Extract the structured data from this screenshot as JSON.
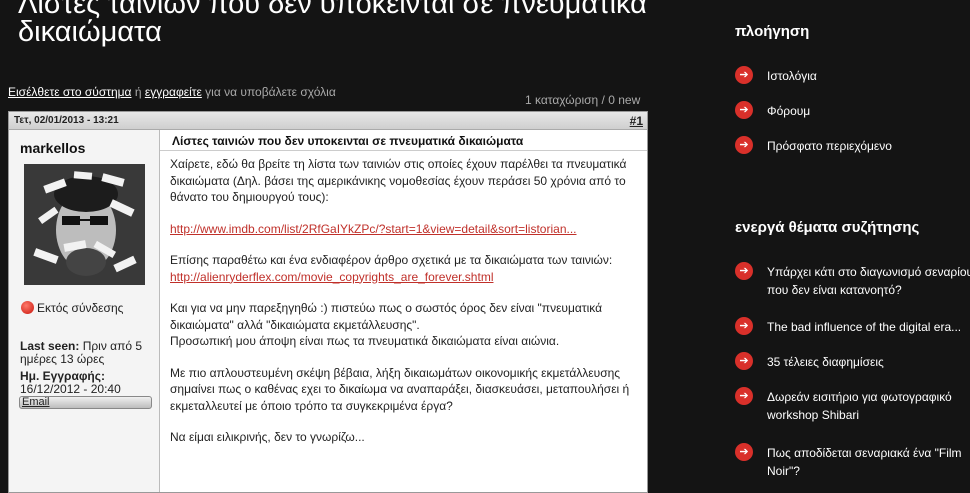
{
  "page": {
    "title": "Λίστες ταινιών που δεν υπόκεινται σε πνευματικά δικαιώματα",
    "login_link": "Εισέλθετε στο σύστημα",
    "login_or": " ή ",
    "register_link": "εγγραφείτε",
    "login_suffix": " για να υποβάλετε σχόλια",
    "post_count": "1 καταχώριση / 0 new"
  },
  "post": {
    "date": "Τετ, 02/01/2013 - 13:21",
    "number": "#1",
    "author": {
      "name": "markellos",
      "status": "Εκτός σύνδεσης",
      "last_seen_label": "Last seen:",
      "last_seen_value": " Πριν από 5 ημέρες 13 ώρες",
      "registered_label": "Ημ. Εγγραφής:",
      "registered_value": "16/12/2012 - 20:40",
      "email_button": "Email"
    },
    "subject": "Λίστες ταινιών που δεν υποκεινται σε πνευματικά δικαιώματα",
    "p1": "Χαίρετε, εδώ θα βρείτε τη λίστα των ταινιών στις οποίες έχουν παρέλθει τα πνευματικά δικαιώματα (Δηλ. βάσει της αμερικάνικης νομοθεσίας έχουν περάσει 50 χρόνια από το θάνατο του δημιουργού τους):",
    "link1": "http://www.imdb.com/list/2RfGaIYkZPc/?start=1&view=detail&sort=listorian...",
    "p2": "Επίσης παραθέτω και ένα ενδιαφέρον άρθρο σχετικά με τα δικαιώματα των ταινιών:",
    "link2": "http://alienryderflex.com/movie_copyrights_are_forever.shtml",
    "p3a": "Και για να μην παρεξηγηθώ :) πιστεύω πως ο σωστός όρος δεν είναι \"πνευματικά δικαιώματα\" αλλά \"δικαιώματα εκμετάλλευσης\".",
    "p3b": "Προσωπική μου άποψη είναι πως τα πνευματικά δικαιώματα είναι αιώνια.",
    "p4": "Με πιο απλουστευμένη σκέψη βέβαια, λήξη δικαιωμάτων οικονομικής εκμετάλλευσης σημαίνει πως ο καθένας εχει το δικαίωμα να αναπαράξει, διασκευάσει, μεταπουλήσει ή εκμεταλλευτεί με όποιο τρόπο τα συγκεκριμένα έργα?",
    "p5": "Να είμαι ειλικρινής, δεν το γνωρίζω..."
  },
  "sidebar": {
    "nav_heading": "πλοήγηση",
    "nav_items": [
      {
        "label": "Ιστολόγια"
      },
      {
        "label": "Φόρουμ"
      },
      {
        "label": "Πρόσφατο περιεχόμενο"
      }
    ],
    "topics_heading": "ενεργά θέματα συζήτησης",
    "topics": [
      {
        "line1": "Υπάρχει κάτι στο διαγωνισμό σεναρίου",
        "line2": "που δεν είναι κατανοητό?"
      },
      {
        "line1": "The bad influence of the digital era...",
        "line2": ""
      },
      {
        "line1": "35 τέλειες διαφημίσεις",
        "line2": ""
      },
      {
        "line1": "Δωρεάν εισιτήριο για φωτογραφικό",
        "line2": "workshop Shibari"
      },
      {
        "line1": "Πως αποδίδεται σεναριακά ένα \"Film",
        "line2": "Noir\"?"
      }
    ],
    "arrow_icon": "arrow-right-icon"
  },
  "colors": {
    "background": "#141414",
    "accent": "#d9302a",
    "link": "#c0302a"
  }
}
